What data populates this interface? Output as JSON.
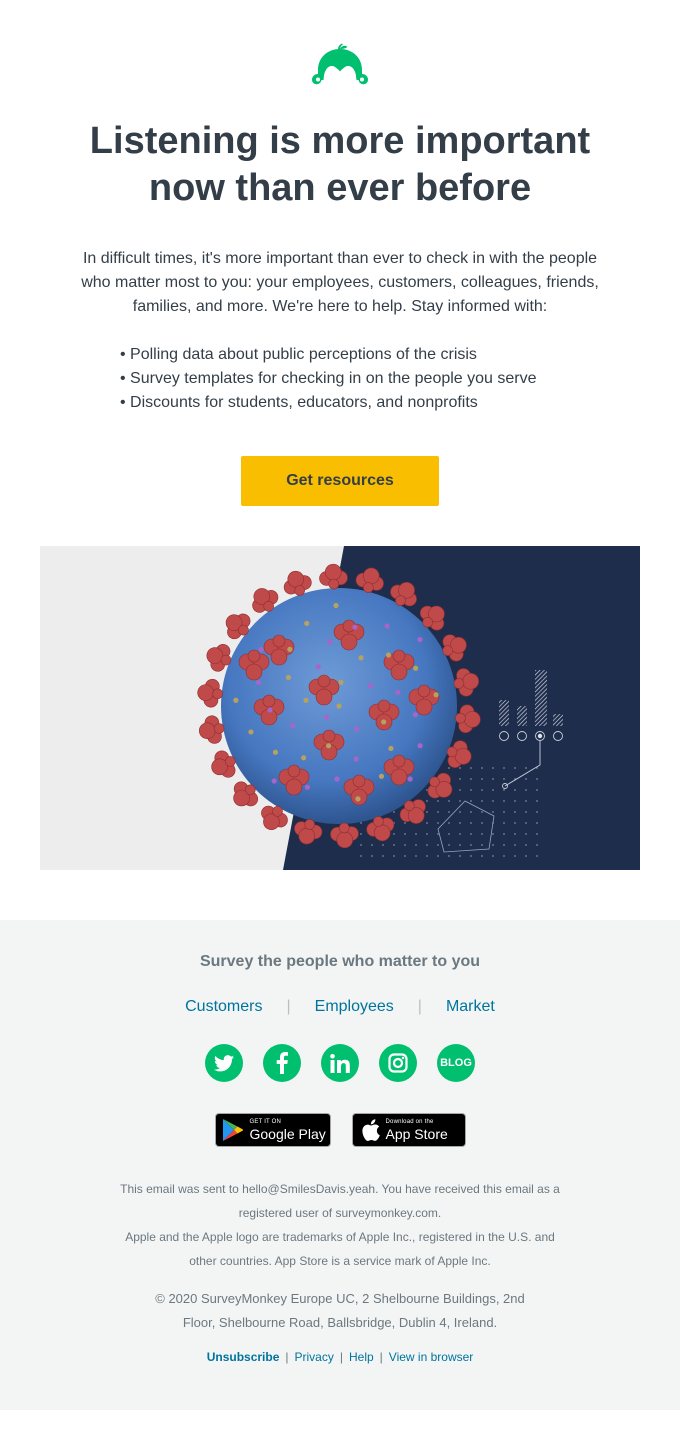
{
  "brand": {
    "name": "SurveyMonkey",
    "logo_icon": "surveymonkey-logo-icon",
    "accent_color": "#00bf6f"
  },
  "headline": {
    "line1": "Listening is more important",
    "line2": "now than ever before"
  },
  "intro": "In difficult times, it's more important than ever to check in with the people who matter most to you: your employees, customers, colleagues, friends, families, and more. We're here to help. Stay informed with:",
  "bullets": [
    "Polling data about public perceptions of the crisis",
    "Survey templates for checking in on the people you serve",
    "Discounts for students, educators, and nonprofits"
  ],
  "cta": {
    "label": "Get resources",
    "color": "#f9be00"
  },
  "hero_image": {
    "description": "coronavirus illustration with data chart graphics",
    "icon": "coronavirus-illustration"
  },
  "footer": {
    "tagline": "Survey the people who matter to you",
    "segment_links": [
      {
        "label": "Customers"
      },
      {
        "label": "Employees"
      },
      {
        "label": "Market"
      }
    ],
    "separator": "|",
    "social": [
      {
        "name": "twitter",
        "icon": "twitter-icon"
      },
      {
        "name": "facebook",
        "icon": "facebook-icon"
      },
      {
        "name": "linkedin",
        "icon": "linkedin-icon"
      },
      {
        "name": "instagram",
        "icon": "instagram-icon"
      },
      {
        "name": "blog",
        "icon": "blog-icon",
        "label": "BLOG"
      }
    ],
    "stores": {
      "google_play": {
        "small": "GET IT ON",
        "big": "Google Play"
      },
      "app_store": {
        "small": "Download on the",
        "big": "App Store"
      }
    },
    "legal_1": "This email was sent to hello@SmilesDavis.yeah. You have received this email as a registered user of surveymonkey.com.",
    "legal_2": "Apple and the Apple logo are trademarks of Apple Inc., registered in the U.S. and other countries. App Store is a service mark of Apple Inc.",
    "address": "© 2020 SurveyMonkey Europe UC, 2 Shelbourne Buildings, 2nd Floor, Shelbourne Road, Ballsbridge, Dublin 4, Ireland.",
    "bottom_links": {
      "unsubscribe": "Unsubscribe",
      "privacy": "Privacy",
      "help": "Help",
      "view_in_browser": "View in browser"
    }
  }
}
